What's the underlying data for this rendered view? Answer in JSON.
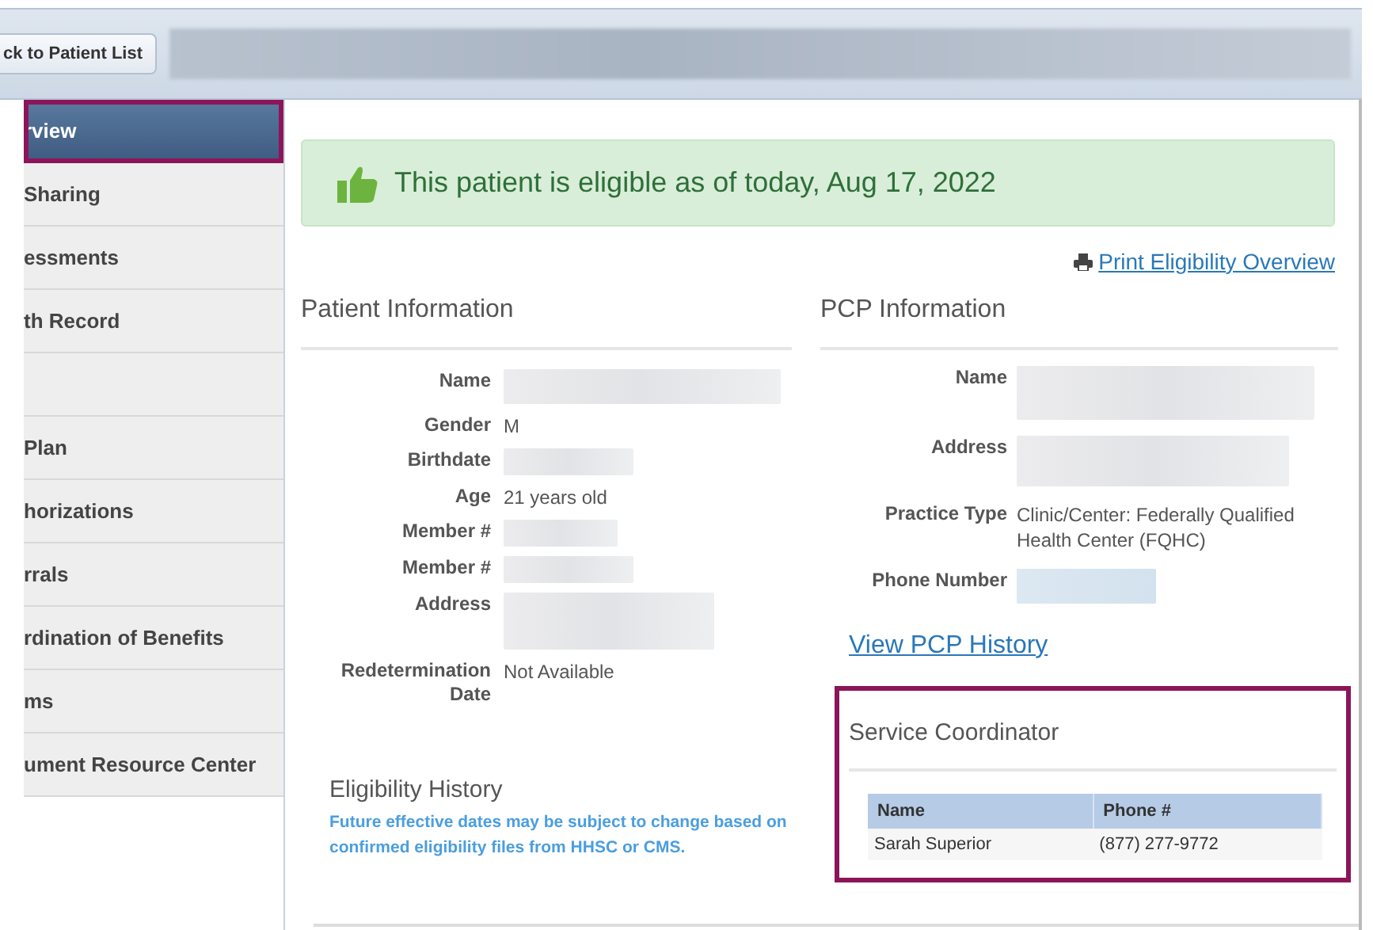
{
  "top_bar": {
    "back_button": "ck to Patient List",
    "search": {
      "kind": "redacted"
    }
  },
  "sidebar": {
    "items": [
      {
        "label": "rview",
        "selected": true
      },
      {
        "label": "Sharing",
        "selected": false
      },
      {
        "label": "essments",
        "selected": false
      },
      {
        "label": "th Record",
        "selected": false
      },
      {
        "selected": false
      },
      {
        "label": "Plan",
        "selected": false
      },
      {
        "label": "horizations",
        "selected": false
      },
      {
        "label": "rrals",
        "selected": false
      },
      {
        "label": "rdination of Benefits",
        "selected": false
      },
      {
        "label": "ms",
        "selected": false
      },
      {
        "label": "ument Resource Center",
        "selected": false
      }
    ]
  },
  "banner": {
    "text": "This patient is eligible as of today, Aug 17, 2022"
  },
  "print_link": "Print Eligibility Overview",
  "patient_information": {
    "title": "Patient Information",
    "fields": [
      {
        "label": "Name",
        "kind": "redacted"
      },
      {
        "label": "Gender",
        "kind": "text",
        "value": "M"
      },
      {
        "label": "Birthdate",
        "kind": "redacted"
      },
      {
        "label": "Age",
        "kind": "text",
        "value": "21 years old"
      },
      {
        "label": "Member #",
        "kind": "redacted"
      },
      {
        "label": "Member #",
        "kind": "redacted"
      },
      {
        "label": "Address",
        "kind": "redacted"
      },
      {
        "label": "Redetermination Date",
        "kind": "text",
        "value": "Not Available"
      }
    ]
  },
  "eligibility_history": {
    "title": "Eligibility History",
    "note": "Future effective dates may be subject to change based on confirmed eligibility files from HHSC or CMS."
  },
  "pcp_information": {
    "title": "PCP Information",
    "fields": [
      {
        "label": "Name",
        "kind": "redacted"
      },
      {
        "label": "Address",
        "kind": "redacted"
      },
      {
        "label": "Practice Type",
        "kind": "text",
        "value": "Clinic/Center: Federally Qualified Health Center (FQHC)"
      },
      {
        "label": "Phone Number",
        "kind": "redacted"
      }
    ],
    "history_link": "View PCP History"
  },
  "service_coordinator": {
    "title": "Service Coordinator",
    "columns": [
      "Name",
      "Phone #"
    ],
    "rows": [
      [
        "Sarah Superior",
        "(877) 277-9772"
      ]
    ]
  }
}
